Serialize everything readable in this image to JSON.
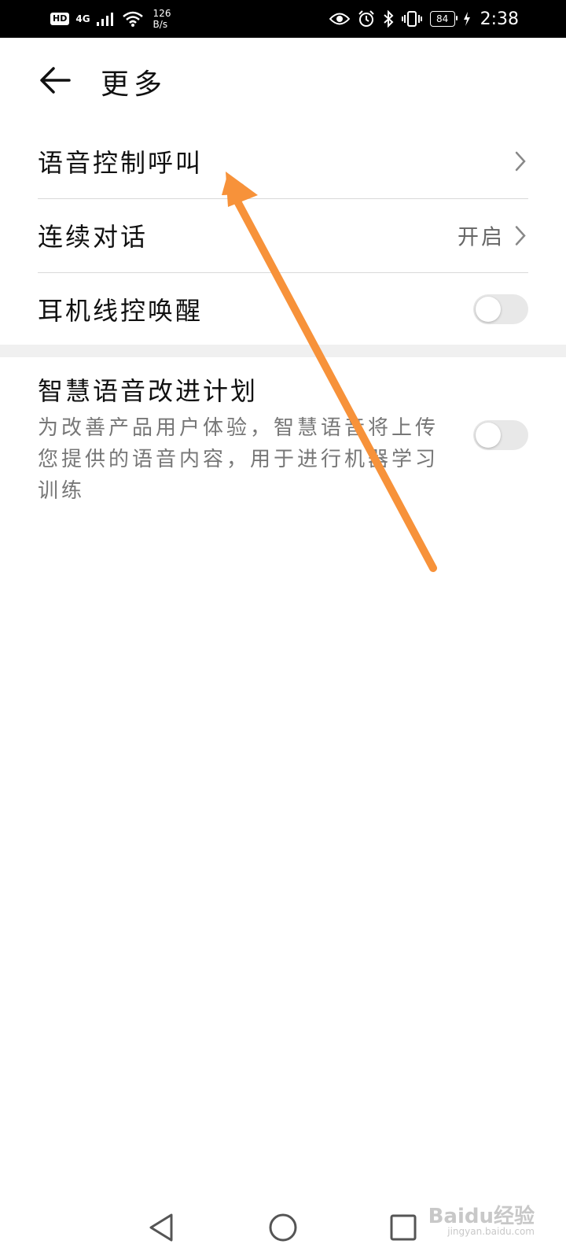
{
  "status_bar": {
    "hd": "HD",
    "network": "4G",
    "speed_value": "126",
    "speed_unit": "B/s",
    "battery": "84",
    "time": "2:38"
  },
  "header": {
    "title": "更多"
  },
  "settings": {
    "voice_call": {
      "label": "语音控制呼叫"
    },
    "continuous_dialog": {
      "label": "连续对话",
      "value": "开启"
    },
    "headset_wakeup": {
      "label": "耳机线控唤醒",
      "enabled": false
    }
  },
  "improvement_plan": {
    "title": "智慧语音改进计划",
    "description": "为改善产品用户体验，智慧语音将上传您提供的语音内容，用于进行机器学习训练",
    "enabled": false
  },
  "watermark": {
    "brand": "Baidu经验",
    "url": "jingyan.baidu.com"
  },
  "colors": {
    "annotation_arrow": "#f7923a",
    "status_bar_bg": "#000000",
    "section_divider": "#f0f0f0"
  }
}
